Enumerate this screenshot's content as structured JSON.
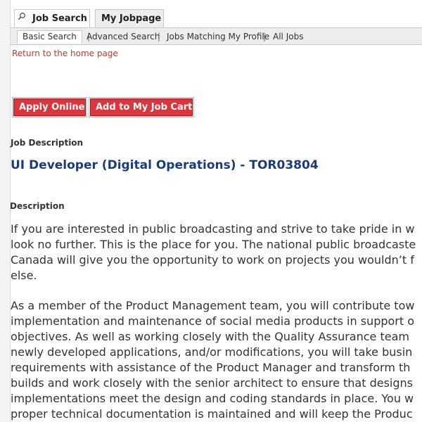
{
  "tabs": [
    {
      "label": "Job Search",
      "icon": "search-icon",
      "active": true
    },
    {
      "label": "My Jobpage",
      "active": false
    }
  ],
  "subnav": {
    "items": [
      "Basic Search",
      "Advanced Search",
      "Jobs Matching My Profile",
      "All Jobs"
    ],
    "separator": "|"
  },
  "home_link": "Return to the home page",
  "buttons": {
    "apply": "Apply Online",
    "cart": "Add to My Job Cart"
  },
  "job_description_heading": "Job Description",
  "job_title": "UI Developer (Digital Operations) - TOR03804",
  "description_heading": "Description",
  "paragraphs": [
    {
      "lines": [
        "If you are interested in public broadcasting and strive to take pride in w",
        "look no further. This is the place for you. The national public broadcaste",
        "Canada will give you the opportunity to work on projects you wouldn’t f",
        "else."
      ]
    },
    {
      "lines": [
        "As a member of the Product Management team, you will contribute tow",
        "implementation and maintenance of social media products in support o",
        "objectives. As well as working closely with the Quality Assurance team",
        "newly developed applications, and/or modifications, you will take busin",
        "requirements with assistance of the Product Manager and transform th",
        "builds and work closely with the senior architect to ensure that designs",
        "implementations meet the design and coding standards in place. You w",
        "proper technical documentation is maintained and will keep the Produc"
      ]
    }
  ],
  "colors": {
    "accent_red": "#d9363e",
    "title_blue": "#1a3c7a",
    "link_red": "#c0392b"
  }
}
